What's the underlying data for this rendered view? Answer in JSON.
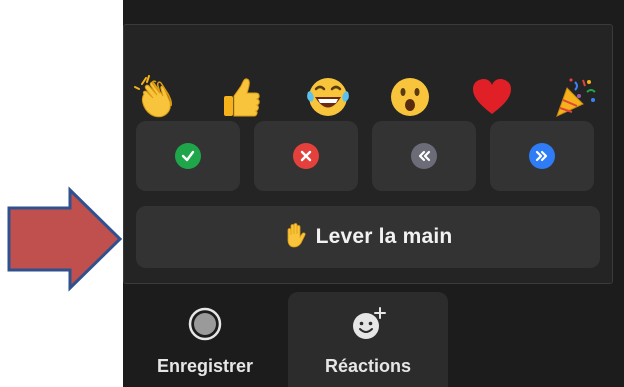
{
  "reactions_panel": {
    "emoji_reactions": [
      {
        "name": "clapping-hands",
        "icon": "clapping-hands-icon"
      },
      {
        "name": "thumbs-up",
        "icon": "thumbs-up-icon"
      },
      {
        "name": "tears-of-joy",
        "icon": "tears-of-joy-icon"
      },
      {
        "name": "open-mouth",
        "icon": "open-mouth-icon"
      },
      {
        "name": "heart",
        "icon": "red-heart-icon"
      },
      {
        "name": "party-popper",
        "icon": "party-popper-icon"
      }
    ],
    "feedback_buttons": [
      {
        "name": "yes",
        "icon": "check-icon",
        "color": "#1fa64a"
      },
      {
        "name": "no",
        "icon": "x-icon",
        "color": "#e5413c"
      },
      {
        "name": "slower",
        "icon": "rewind-icon",
        "color": "#6c6c78"
      },
      {
        "name": "faster",
        "icon": "fast-forward-icon",
        "color": "#2e7cf6"
      }
    ],
    "raise_hand": {
      "label": "Lever la main",
      "icon": "raised-hand-icon"
    }
  },
  "toolbar": {
    "record_label": "Enregistrer",
    "record_icon": "record-icon",
    "reactions_label": "Réactions",
    "reactions_icon": "smiley-add-icon"
  },
  "colors": {
    "panel_bg": "#242424",
    "button_bg": "#333333",
    "arrow_fill": "#c0504d",
    "arrow_stroke": "#2f528f"
  }
}
